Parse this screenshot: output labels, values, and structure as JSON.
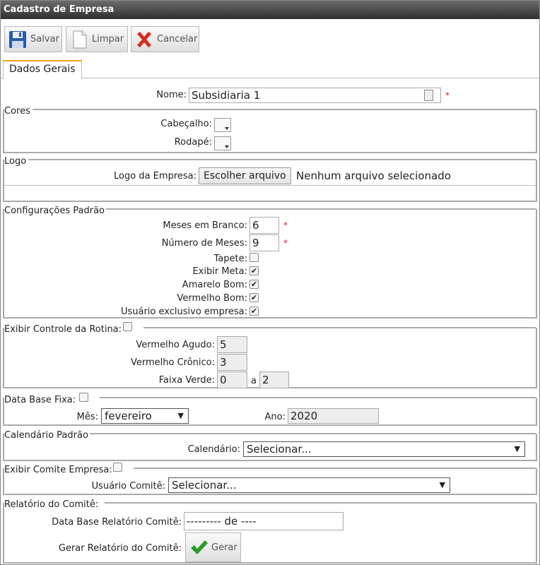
{
  "window": {
    "title": "Cadastro de Empresa"
  },
  "toolbar": {
    "save_label": "Salvar",
    "clear_label": "Limpar",
    "cancel_label": "Cancelar"
  },
  "tabs": [
    {
      "label": "Dados Gerais"
    }
  ],
  "form": {
    "nome": {
      "label": "Nome:",
      "value": "Subsidiaria 1",
      "required": "*"
    },
    "cores": {
      "legend": "Cores",
      "cabecalho_label": "Cabeçalho:",
      "rodape_label": "Rodapé:"
    },
    "logo": {
      "legend": "Logo",
      "label": "Logo da Empresa:",
      "button": "Escolher arquivo",
      "status": "Nenhum arquivo selecionado"
    },
    "config": {
      "legend": "Configurações Padrão",
      "meses_branco_label": "Meses em Branco:",
      "meses_branco_value": "6",
      "numero_meses_label": "Número de Meses:",
      "numero_meses_value": "9",
      "required": "*",
      "tapete_label": "Tapete:",
      "tapete_checked": false,
      "exibir_meta_label": "Exibir Meta:",
      "exibir_meta_checked": true,
      "amarelo_bom_label": "Amarelo Bom:",
      "amarelo_bom_checked": true,
      "vermelho_bom_label": "Vermelho Bom:",
      "vermelho_bom_checked": true,
      "usuario_exclusivo_label": "Usuário exclusivo empresa:",
      "usuario_exclusivo_checked": true,
      "check_mark": "✔"
    },
    "rotina": {
      "legend": "Exibir Controle da Rotina:",
      "vermelho_agudo_label": "Vermelho Agudo:",
      "vermelho_agudo_value": "5",
      "vermelho_cronico_label": "Vermelho Crônico:",
      "vermelho_cronico_value": "3",
      "faixa_verde_label": "Faixa Verde:",
      "faixa_verde_from": "0",
      "faixa_verde_sep": "a",
      "faixa_verde_to": "2"
    },
    "data_base": {
      "legend": "Data Base Fixa:",
      "mes_label": "Mês:",
      "mes_value": "fevereiro",
      "ano_label": "Ano:",
      "ano_value": "2020"
    },
    "calendario": {
      "legend": "Calendário Padrão",
      "label": "Calendário:",
      "value": "Selecionar..."
    },
    "comite": {
      "legend": "Exibir Comite Empresa:",
      "usuario_label": "Usuário Comitê:",
      "usuario_value": "Selecionar..."
    },
    "relatorio": {
      "legend": "Relatório do Comitê:",
      "data_base_label": "Data Base Relatório Comitê:",
      "data_base_value": "--------- de ----",
      "gerar_label": "Gerar Relatório do Comitê:",
      "gerar_button": "Gerar"
    },
    "dropdown_arrow": "▼"
  },
  "colors": {
    "required": "#dd2222",
    "tab_accent": "#f0a020",
    "save_icon": "#2b5aa8",
    "cancel_icon": "#d62a1e",
    "gerar_icon": "#2a9a2a"
  }
}
